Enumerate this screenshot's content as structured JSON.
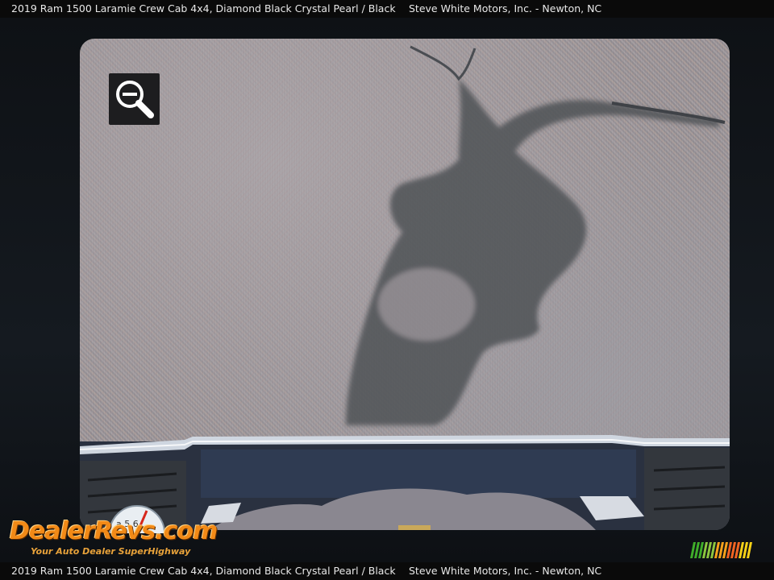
{
  "caption": {
    "vehicle": "2019 Ram 1500 Laramie Crew Cab 4x4,  Diamond Black Crystal Pearl / Black",
    "dealer": "Steve White Motors, Inc. - Newton, NC"
  },
  "camera_screen": {
    "zoom_button": {
      "icon": "zoom-out-icon"
    }
  },
  "watermark": {
    "logo_text": "DealerRevs.com",
    "tagline": "Your Auto Dealer SuperHighway",
    "gauge_digits": "a 5 6",
    "stripe_colors": [
      "#3fae2a",
      "#8cc63f",
      "#f7a21b",
      "#f26522",
      "#f7d117"
    ]
  }
}
